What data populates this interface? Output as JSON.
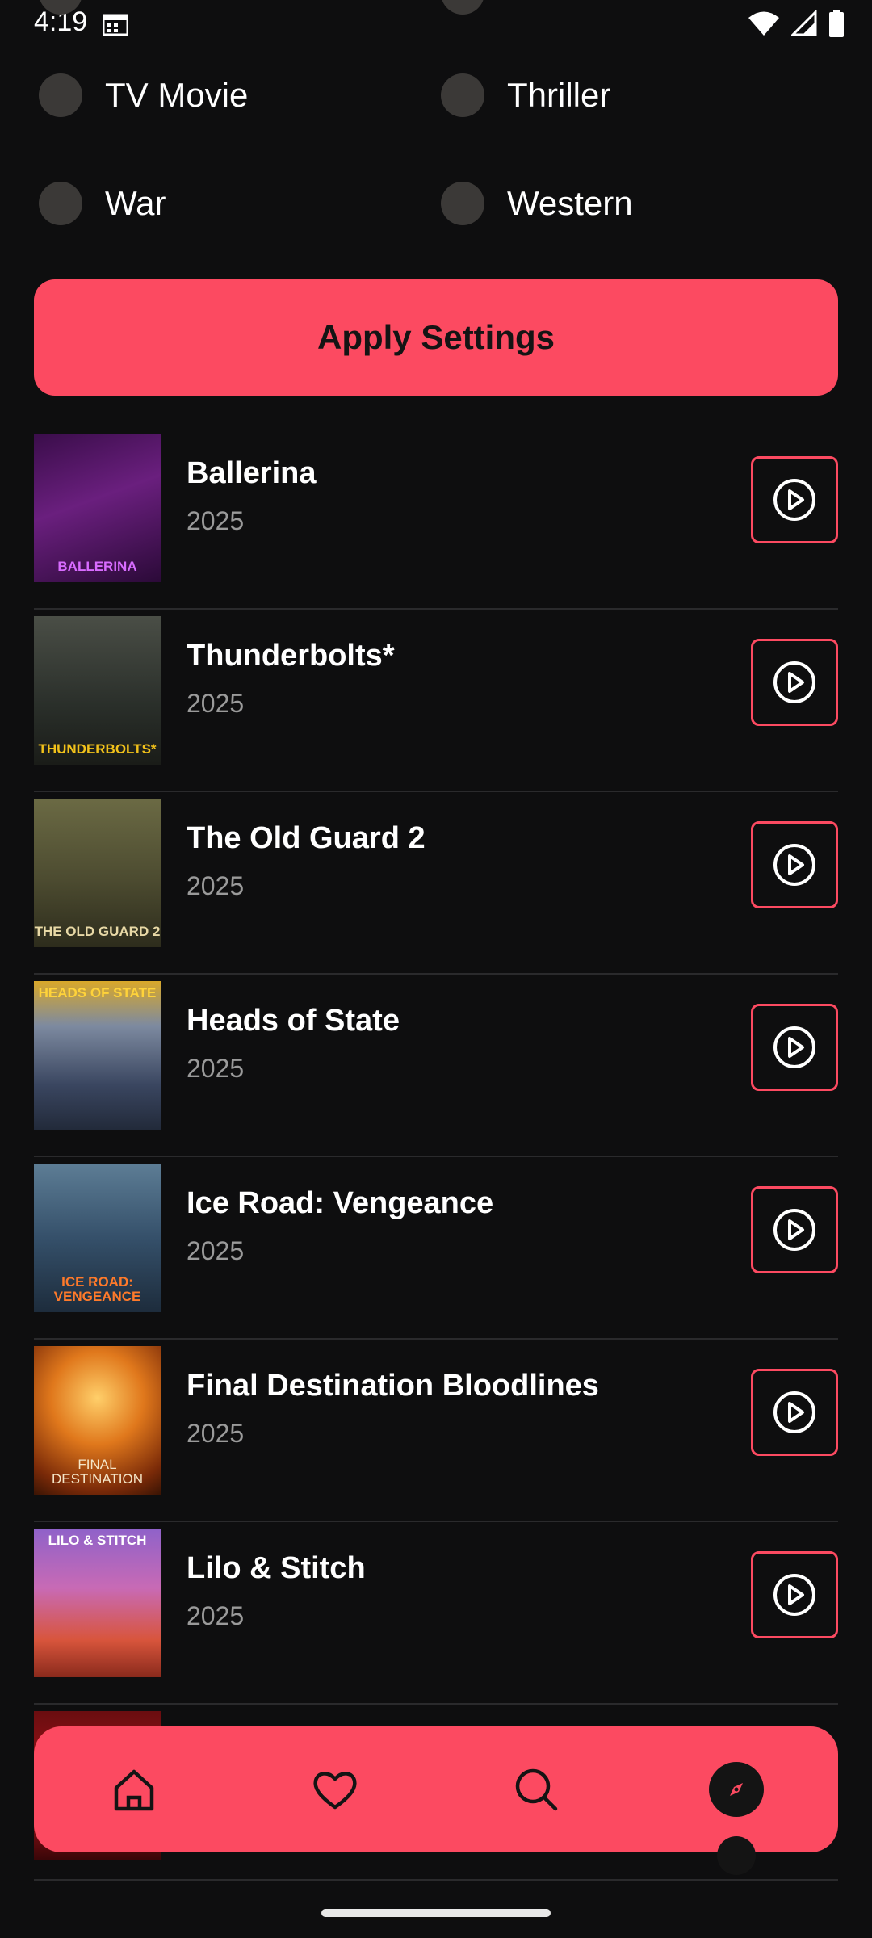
{
  "status_bar": {
    "time": "4:19"
  },
  "genres": [
    {
      "label": "TV Movie"
    },
    {
      "label": "Thriller"
    },
    {
      "label": "War"
    },
    {
      "label": "Western"
    }
  ],
  "apply_button": {
    "label": "Apply Settings"
  },
  "movies": [
    {
      "title": "Ballerina",
      "year": "2025",
      "poster_text": "BALLERINA"
    },
    {
      "title": "Thunderbolts*",
      "year": "2025",
      "poster_text": "THUNDERBOLTS*"
    },
    {
      "title": "The Old Guard 2",
      "year": "2025",
      "poster_text": "THE OLD GUARD 2"
    },
    {
      "title": "Heads of State",
      "year": "2025",
      "poster_text": "HEADS OF STATE"
    },
    {
      "title": "Ice Road: Vengeance",
      "year": "2025",
      "poster_text": "ICE ROAD: VENGEANCE"
    },
    {
      "title": "Final Destination Bloodlines",
      "year": "2025",
      "poster_text": "FINAL DESTINATION"
    },
    {
      "title": "Lilo & Stitch",
      "year": "2025",
      "poster_text": "LILO & STITCH"
    }
  ],
  "bottom_nav": {
    "items": [
      {
        "icon": "home-icon"
      },
      {
        "icon": "heart-icon"
      },
      {
        "icon": "search-icon"
      },
      {
        "icon": "compass-icon",
        "active": true
      }
    ]
  },
  "colors": {
    "accent": "#fc4a61",
    "background": "#0e0e0f",
    "radio": "#3b3937",
    "year_text": "#9a9a9a"
  }
}
